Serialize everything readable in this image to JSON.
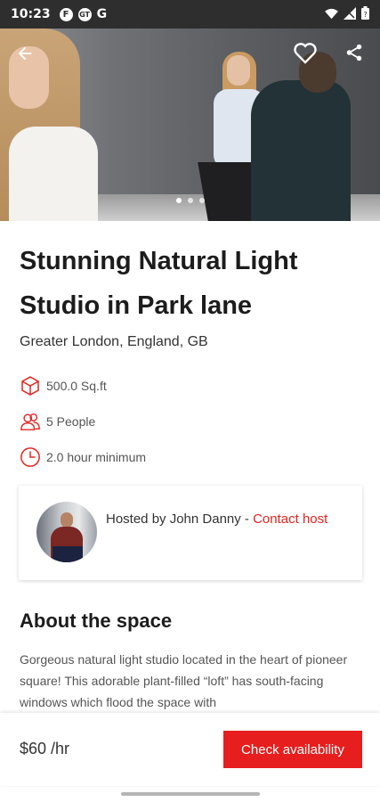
{
  "status_bar": {
    "time": "10:23",
    "notifications": [
      "F",
      "GT",
      "G"
    ],
    "icons": [
      "wifi-icon",
      "signal-icon",
      "battery-icon"
    ]
  },
  "hero": {
    "icons": {
      "back": "arrow-left-icon",
      "favorite": "heart-icon",
      "share": "share-icon"
    },
    "page_count": 3,
    "active_page": 1
  },
  "listing": {
    "title": "Stunning Natural Light Studio in Park lane",
    "location": "Greater London, England, GB",
    "features": [
      {
        "icon": "cube-icon",
        "text": "500.0 Sq.ft"
      },
      {
        "icon": "people-icon",
        "text": "5 People"
      },
      {
        "icon": "clock-icon",
        "text": "2.0 hour minimum"
      }
    ]
  },
  "host": {
    "prefix": "Hosted by John Danny - ",
    "contact_label": "Contact host"
  },
  "about": {
    "title": "About the space",
    "text": "Gorgeous natural light studio located in the heart of pioneer square! This adorable plant-filled “loft” has south-facing windows which flood the space with"
  },
  "booking": {
    "price": "$60 /hr",
    "cta_label": "Check availability"
  },
  "colors": {
    "accent": "#e61e1e",
    "status_bar": "#2e2e2e"
  }
}
